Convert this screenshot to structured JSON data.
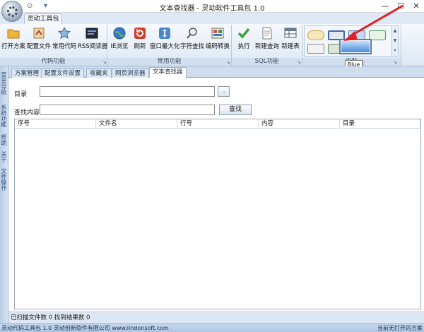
{
  "window": {
    "title": "文本查找器 - 灵动软件工具包 1.0",
    "minimize": "—",
    "maximize": "☐",
    "close": "✕"
  },
  "ribbon": {
    "tab": "灵动工具包",
    "groups": [
      {
        "label": "代码功能",
        "buttons": [
          {
            "label": "打开方案",
            "icon": "folder-icon"
          },
          {
            "label": "配置文件",
            "icon": "config-file-icon"
          },
          {
            "label": "常用代码",
            "icon": "star-icon"
          },
          {
            "label": "RSS阅读器",
            "icon": "rss-reader-icon"
          }
        ]
      },
      {
        "label": "常用功能",
        "buttons": [
          {
            "label": "IE浏览",
            "icon": "globe-icon"
          },
          {
            "label": "刷新",
            "icon": "refresh-icon"
          },
          {
            "label": "窗口最大化",
            "icon": "maximize-icon"
          },
          {
            "label": "字符查找",
            "icon": "magnifier-icon"
          },
          {
            "label": "编码转换",
            "icon": "encoding-icon"
          }
        ]
      },
      {
        "label": "SQL功能",
        "buttons": [
          {
            "label": "执行",
            "icon": "checkmark-icon"
          },
          {
            "label": "新建查询",
            "icon": "new-query-icon"
          },
          {
            "label": "新建表",
            "icon": "new-table-icon"
          }
        ]
      }
    ],
    "skin_group_label": "皮肤",
    "tooltip": "Blue",
    "colors": {
      "accent": "#3f84d6",
      "arrow": "#e0202a"
    }
  },
  "sidebar": {
    "items": [
      "菜单导航",
      "系统功能",
      "帮助",
      "关于",
      "文件操作"
    ]
  },
  "doc_tabs": [
    "方案管理",
    "配置文件设置",
    "收藏夹",
    "网页浏览器",
    "文本查找器"
  ],
  "form": {
    "dir_label": "目录",
    "dir_value": "",
    "browse_label": "..",
    "content_label": "查找内容",
    "content_value": "",
    "search_label": "查找"
  },
  "grid": {
    "columns": [
      "序号",
      "文件名",
      "行号",
      "内容",
      "目录"
    ]
  },
  "status": {
    "scanned": "已扫描文件数  0   找到结果数  0",
    "footer_left": "灵动代码工具包 1.0   灵动创新软件有限公司 www.lindonsoft.com",
    "footer_right": "当前无打开的方案"
  }
}
